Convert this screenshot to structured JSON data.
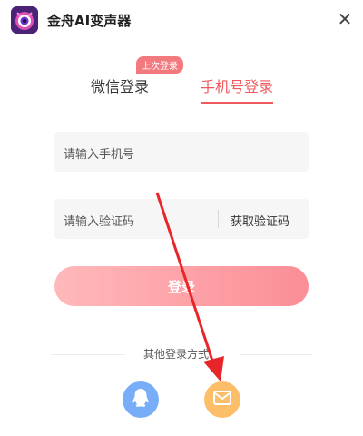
{
  "app": {
    "title": "金舟AI变声器"
  },
  "tabs": {
    "items": [
      {
        "label": "微信登录",
        "active": false
      },
      {
        "label": "手机号登录",
        "active": true
      }
    ],
    "last_login_badge": "上次登录"
  },
  "form": {
    "phone_placeholder": "请输入手机号",
    "code_placeholder": "请输入验证码",
    "get_code_label": "获取验证码",
    "login_label": "登录"
  },
  "other": {
    "label": "其他登录方式",
    "options": [
      {
        "icon": "qq-icon"
      },
      {
        "icon": "mail-icon"
      }
    ]
  },
  "icons": {
    "close": "close-icon",
    "logo": "app-logo-icon"
  },
  "colors": {
    "accent": "#f0595e",
    "login_start": "#ffb9bb",
    "login_end": "#fb8e96",
    "qq": "#78aef8",
    "mail": "#fdbe6a",
    "annotation": "#e8262a"
  }
}
